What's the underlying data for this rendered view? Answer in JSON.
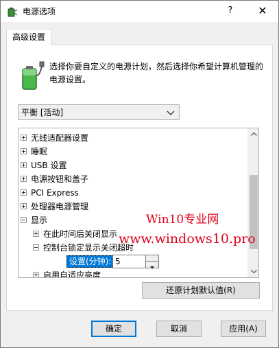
{
  "window": {
    "title": "电源选项",
    "help_glyph": "?",
    "close_glyph": "✕"
  },
  "tab": {
    "label": "高级设置"
  },
  "description": "选择你要自定义的电源计划，然后选择你希望计算机管理的电源设置。",
  "plan_dropdown": {
    "selected": "平衡 [活动]"
  },
  "tree_items": [
    {
      "label": "无线适配器设置",
      "expander": "plus"
    },
    {
      "label": "睡眠",
      "expander": "plus"
    },
    {
      "label": "USB 设置",
      "expander": "plus"
    },
    {
      "label": "电源按钮和盖子",
      "expander": "plus"
    },
    {
      "label": "PCI Express",
      "expander": "plus"
    },
    {
      "label": "处理器电源管理",
      "expander": "plus"
    },
    {
      "label": "显示",
      "expander": "minus"
    },
    {
      "label": "在此时间后关闭显示",
      "expander": "plus"
    },
    {
      "label": "控制台锁定显示关闭超时",
      "expander": "minus"
    },
    {
      "label": "启用自适应亮度",
      "expander": "plus"
    }
  ],
  "setting": {
    "label": "设置(分钟):",
    "value": "5"
  },
  "buttons": {
    "restore_defaults": "还原计划默认值(R)",
    "ok": "确定",
    "cancel": "取消",
    "apply": "应用(A)"
  },
  "watermark": {
    "line1": "Win10专业网",
    "line2": "www.windows10.pro"
  },
  "colors": {
    "accent": "#0078d7",
    "watermark": "#e0001a",
    "dialog_bg": "#f0f0f0"
  },
  "icons": {
    "app": "power-options-icon",
    "battery": "battery-plug-icon"
  }
}
